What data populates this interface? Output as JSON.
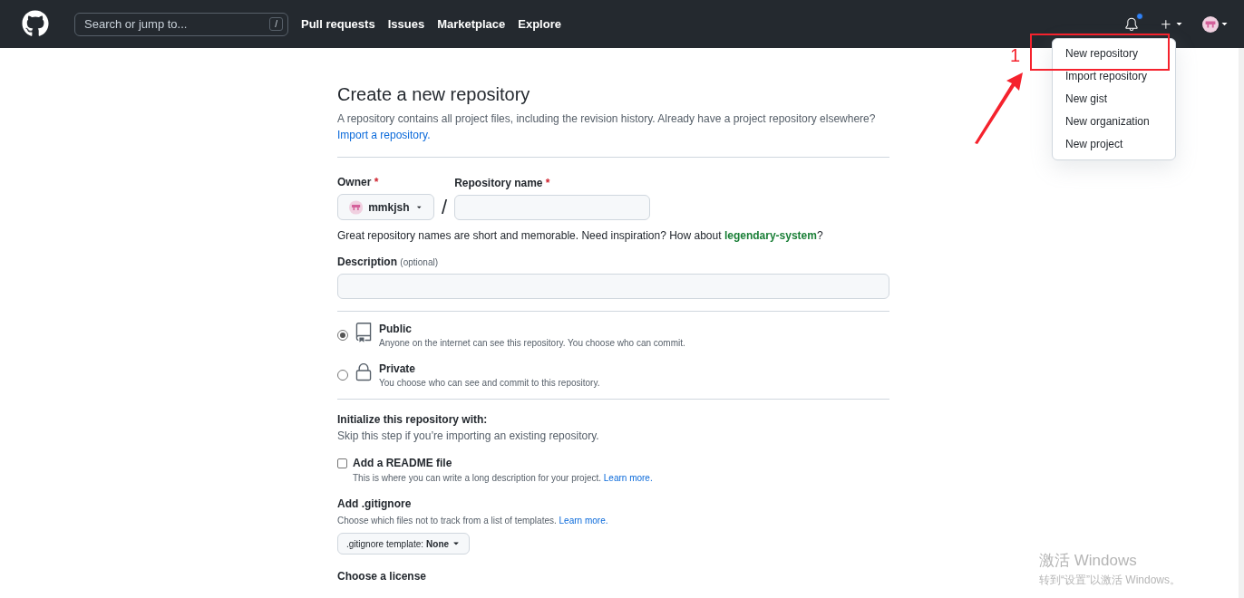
{
  "header": {
    "search_placeholder": "Search or jump to...",
    "search_key": "/",
    "nav": [
      "Pull requests",
      "Issues",
      "Marketplace",
      "Explore"
    ],
    "notification_unread": true
  },
  "create_menu": {
    "items": [
      {
        "label": "New repository",
        "highlighted": true
      },
      {
        "label": "Import repository",
        "highlighted": false
      },
      {
        "label": "New gist",
        "highlighted": false
      },
      {
        "label": "New organization",
        "highlighted": false
      },
      {
        "label": "New project",
        "highlighted": false
      }
    ]
  },
  "annotation": {
    "marker": "1"
  },
  "form": {
    "title": "Create a new repository",
    "intro": "A repository contains all project files, including the revision history. Already have a project repository elsewhere?",
    "import_link": "Import a repository.",
    "owner_label": "Owner",
    "repo_label": "Repository name",
    "required_mark": "*",
    "owner": "mmkjsh",
    "separator": "/",
    "hint": "Great repository names are short and memorable. Need inspiration? How about **legendary-system**?",
    "description_label": "Description",
    "description_note": "(optional)",
    "visibility": [
      {
        "kind": "public",
        "label": "Public",
        "description": "Anyone on the internet can see this repository. You choose who can commit.",
        "selected": true
      },
      {
        "kind": "private",
        "label": "Private",
        "description": "You choose who can see and commit to this repository.",
        "selected": false
      }
    ],
    "init_title": "Initialize this repository with:",
    "init_description": "Skip this step if you’re importing an existing repository.",
    "readme": {
      "label": "Add a README file",
      "checked": false,
      "description": "This is where you can write a long description for your project.",
      "link": "Learn more."
    },
    "gitignore": {
      "title": "Add .gitignore",
      "description": "Choose which files not to track from a list of templates.",
      "link": "Learn more.",
      "button_label": ".gitignore template:",
      "button_value": "None"
    },
    "license_title": "Choose a license"
  },
  "os_notice": {
    "title": "激活 Windows",
    "text": "转到“设置”以激活 Windows。"
  }
}
